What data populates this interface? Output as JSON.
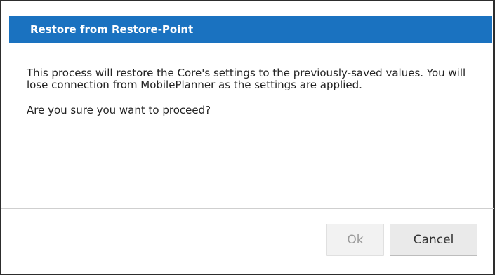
{
  "dialog": {
    "title": "Restore from Restore-Point",
    "message": "This process will restore the Core's settings to the previously-saved values. You will lose connection from MobilePlanner as the settings are applied.",
    "question": "Are you sure you want to proceed?",
    "buttons": {
      "ok_label": "Ok",
      "ok_enabled": false,
      "cancel_label": "Cancel"
    },
    "colors": {
      "title_bar": "#1a72c0",
      "title_text": "#ffffff",
      "border": "#2d2d2d"
    }
  }
}
